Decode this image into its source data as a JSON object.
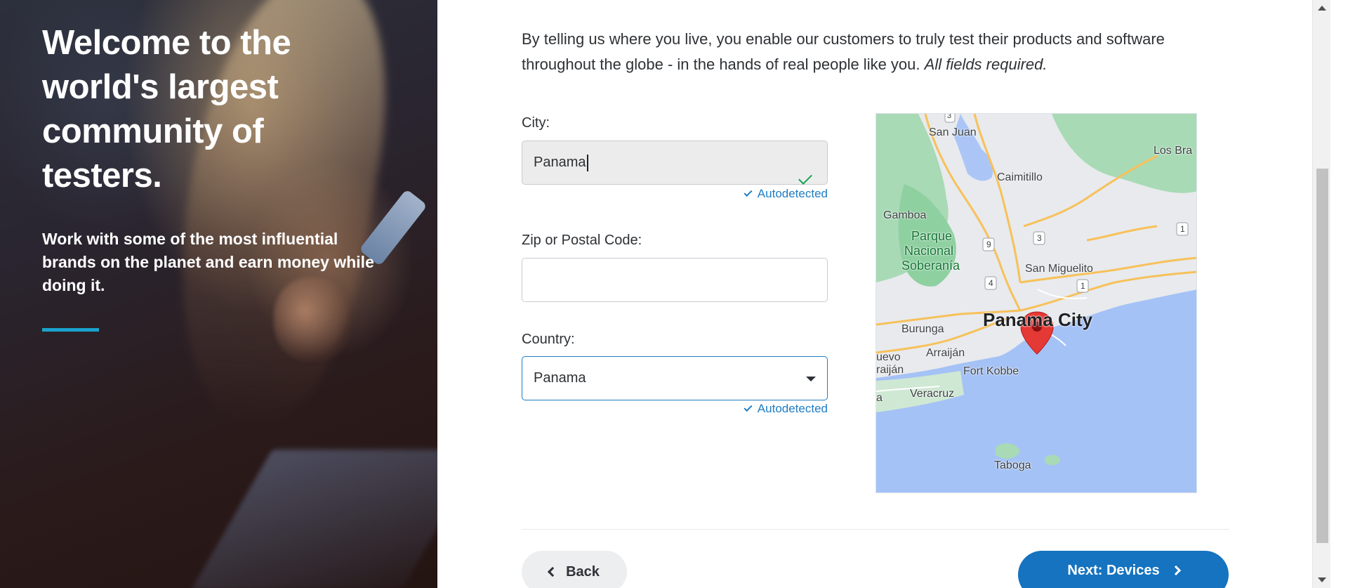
{
  "hero": {
    "headline": "Welcome to the world's largest community of testers.",
    "subtext": "Work with some of the most influential brands on the planet and earn money while doing it."
  },
  "intro": {
    "text": "By telling us where you live, you enable our customers to truly test their products and software throughout the globe - in the hands of real people like you.",
    "required_note": "All fields required."
  },
  "form": {
    "city": {
      "label": "City:",
      "value": "Panama",
      "autodetected": "Autodetected"
    },
    "zip": {
      "label": "Zip or Postal Code:",
      "value": ""
    },
    "country": {
      "label": "Country:",
      "selected": "Panama",
      "autodetected": "Autodetected"
    }
  },
  "map": {
    "labels": {
      "san_juan": "San Juan",
      "los_bra": "Los Bra",
      "caimitillo": "Caimitillo",
      "gamboa": "Gamboa",
      "parque": "Parque",
      "nacional": "Nacional",
      "soberania": "Soberanía",
      "san_miguelito": "San Miguelito",
      "panama_city": "Panama City",
      "burunga": "Burunga",
      "uevo": "uevo",
      "arraijan": "Arraiján",
      "raijan": "raiján",
      "fort_kobbe": "Fort Kobbe",
      "veracruz": "Veracruz",
      "a": "a",
      "taboga": "Taboga"
    },
    "shields": [
      "3",
      "9",
      "3",
      "1",
      "4",
      "1"
    ]
  },
  "actions": {
    "back_label": "Back",
    "next_label": "Next: Devices"
  },
  "colors": {
    "accent": "#1aa3cc",
    "primary": "#1573bf",
    "link": "#1e7cc4",
    "success": "#19a356"
  }
}
